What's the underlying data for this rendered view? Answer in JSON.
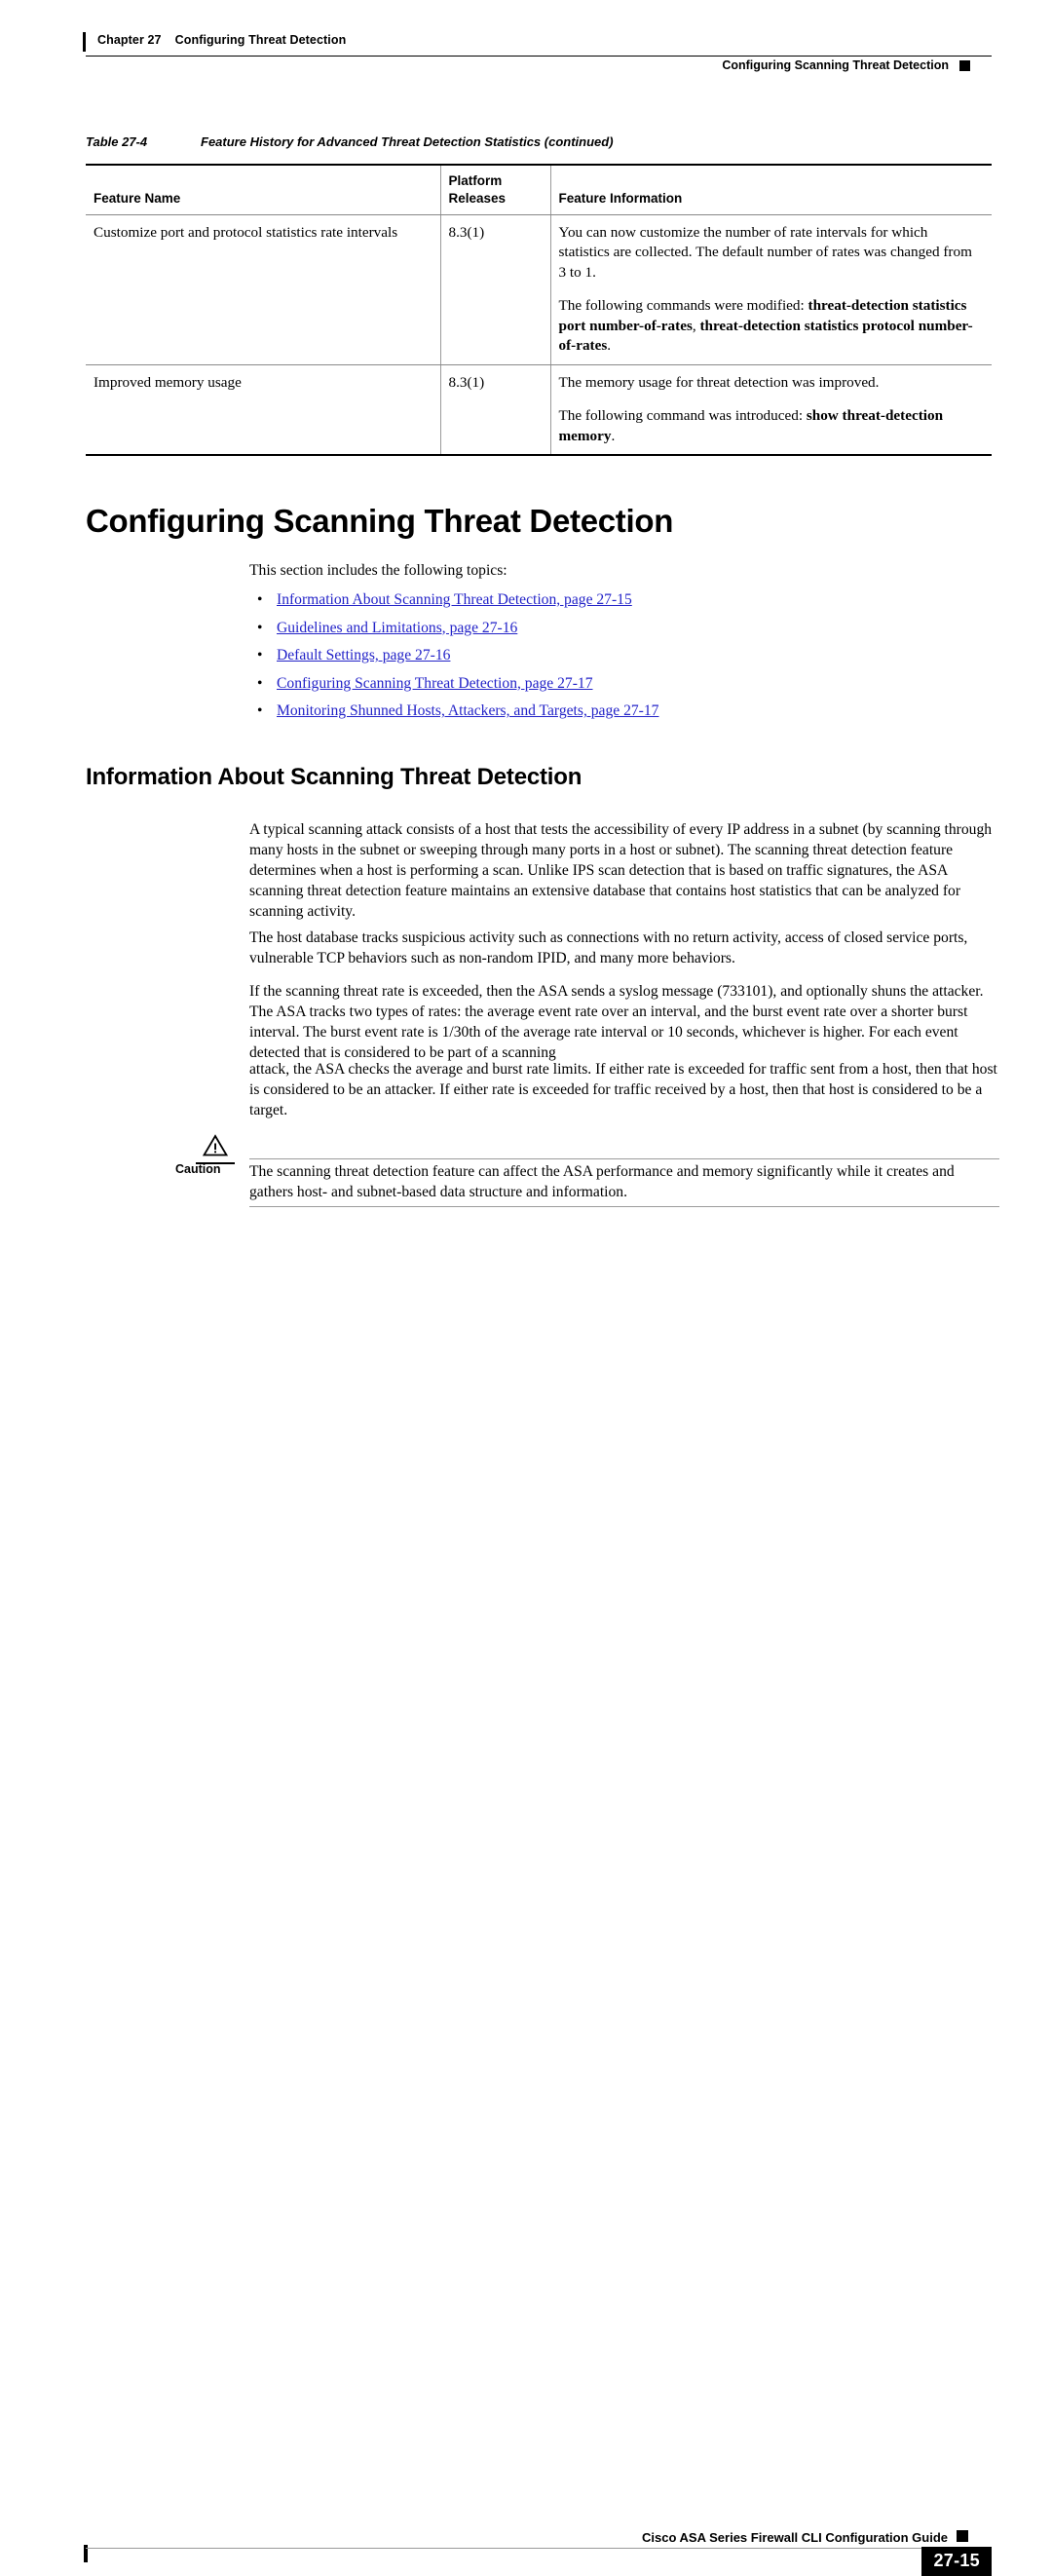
{
  "header": {
    "chapter_number": "Chapter 27",
    "chapter_title": "Configuring Threat Detection",
    "running_head_right": "Configuring Scanning Threat Detection"
  },
  "table": {
    "caption_label": "Table 27-4",
    "caption_title": "Feature History for Advanced Threat Detection Statistics (continued)",
    "columns": [
      {
        "header": "Feature Name",
        "header_line1": "",
        "header_line2": "Feature Name"
      },
      {
        "header": "Platform Releases",
        "header_line1": "Platform",
        "header_line2": "Releases"
      },
      {
        "header": "Feature Information",
        "header_line1": "",
        "header_line2": "Feature Information"
      }
    ],
    "rows": [
      {
        "feature_name": "Customize port and protocol statistics rate intervals",
        "platform_release": "8.3(1)",
        "info_para1": "You can now customize the number of rate intervals for which statistics are collected. The default number of rates was changed from 3 to 1.",
        "info_para2_prefix": "The following commands were modified: ",
        "info_para2_cmd1": "threat-detection statistics port number-of-rates",
        "info_para2_sep": ", ",
        "info_para2_cmd2": "threat-detection statistics protocol number-of-rates",
        "info_para2_suffix": "."
      },
      {
        "feature_name": "Improved memory usage",
        "platform_release": "8.3(1)",
        "info_para1": "The memory usage for threat detection was improved.",
        "info_para2_prefix": "The following command was introduced: ",
        "info_para2_cmd1": "show threat-detection memory",
        "info_para2_sep": "",
        "info_para2_cmd2": "",
        "info_para2_suffix": "."
      }
    ]
  },
  "sections": {
    "main_heading": "Configuring Scanning Threat Detection",
    "intro_line": "This section includes the following topics:",
    "toc_links": [
      "Information About Scanning Threat Detection, page 27-15",
      "Guidelines and Limitations, page 27-16",
      "Default Settings, page 27-16",
      "Configuring Scanning Threat Detection, page 27-17",
      "Monitoring Shunned Hosts, Attackers, and Targets, page 27-17"
    ],
    "sub_heading": "Information About Scanning Threat Detection",
    "paragraphs": [
      "A typical scanning attack consists of a host that tests the accessibility of every IP address in a subnet (by scanning through many hosts in the subnet or sweeping through many ports in a host or subnet). The scanning threat detection feature determines when a host is performing a scan. Unlike IPS scan detection that is based on traffic signatures, the ASA scanning threat detection feature maintains an extensive database that contains host statistics that can be analyzed for scanning activity.",
      "The host database tracks suspicious activity such as connections with no return activity, access of closed service ports, vulnerable TCP behaviors such as non-random IPID, and many more behaviors.",
      "If the scanning threat rate is exceeded, then the ASA sends a syslog message (733101), and optionally shuns the attacker. The ASA tracks two types of rates: the average event rate over an interval, and the burst event rate over a shorter burst interval. The burst event rate is 1/30th of the average rate interval or 10 seconds, whichever is higher. For each event detected that is considered to be part of a scanning",
      "attack, the ASA checks the average and burst rate limits. If either rate is exceeded for traffic sent from a host, then that host is considered to be an attacker. If either rate is exceeded for traffic received by a host, then that host is considered to be a target."
    ]
  },
  "caution": {
    "label": "Caution",
    "icon": "warning-triangle-icon",
    "text": "The scanning threat detection feature can affect the ASA performance and memory significantly while it creates and gathers host- and subnet-based data structure and information."
  },
  "footer": {
    "guide_title": "Cisco ASA Series Firewall CLI Configuration Guide",
    "page_number": "27-15"
  },
  "colors": {
    "link": "#2323c8",
    "rule": "#9b9b9b",
    "text": "#000000"
  }
}
